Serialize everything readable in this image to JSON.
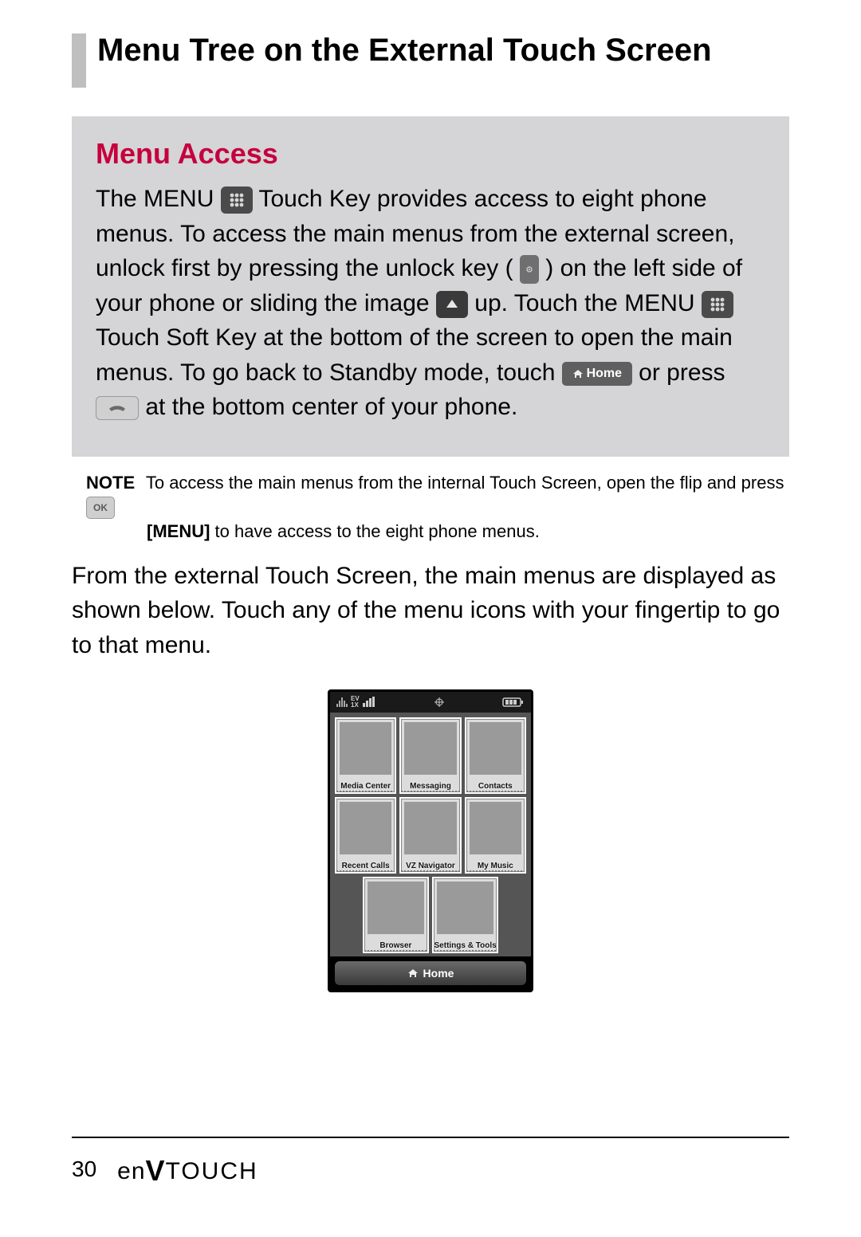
{
  "header": {
    "title": "Menu Tree on the External Touch Screen"
  },
  "callout": {
    "heading": "Menu Access",
    "p1a": "The MENU ",
    "p1b": " Touch Key provides access to eight phone menus. To access the main menus from the external screen, unlock first by pressing the unlock key ( ",
    "p1c": " ) on the left side of your phone or sliding the image ",
    "p1d": " up. Touch the MENU ",
    "p1e": " Touch Soft Key at the bottom of the screen to open the main menus. To go back to Standby mode, touch ",
    "p1f": " or press  ",
    "p1g": "  at the bottom center of your phone.",
    "home_label": "Home"
  },
  "note": {
    "label": "NOTE",
    "line1": "To access the main menus from the internal Touch Screen, open the flip and press ",
    "line2_menu": "[MENU]",
    "line2_rest": " to have access to the eight phone menus.",
    "ok_label": "OK"
  },
  "after_note": "From the external Touch Screen, the main menus are displayed as shown below. Touch any of the menu icons with your fingertip to go to that menu.",
  "phone": {
    "tx_label": "EV\n1X",
    "tiles": [
      "Media Center",
      "Messaging",
      "Contacts",
      "Recent Calls",
      "VZ Navigator",
      "My Music",
      "Browser",
      "Settings & Tools"
    ],
    "home_label": "Home"
  },
  "footer": {
    "page_number": "30",
    "brand_en": "en",
    "brand_v": "V",
    "brand_touch": "TOUCH"
  }
}
